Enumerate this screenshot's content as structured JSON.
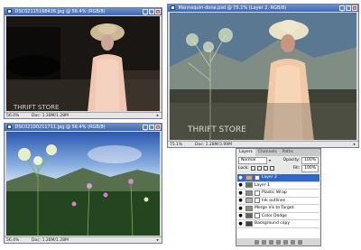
{
  "windows": [
    {
      "title": "DSC02115168426.jpg @ 56.4% (RGB/8)",
      "zoom": "56.4%",
      "doc": "Doc: 1.28M/1.28M",
      "sign_text": "THRIFT STORE"
    },
    {
      "title": "Mannequin-done.psd @ 75.1% (Layer 2, RGB/8)",
      "zoom": "75.1%",
      "doc": "Doc: 1.28M/3.99M",
      "sign_text": "THRIFT STORE"
    },
    {
      "title": "DSC02100211711.jpg @ 56.4% (RGB/8)",
      "zoom": "56.4%",
      "doc": "Doc: 1.28M/1.28M"
    }
  ],
  "layers_panel": {
    "tabs": [
      "Layers",
      "Channels",
      "Paths"
    ],
    "blend_mode": "Normal",
    "opacity_label": "Opacity:",
    "opacity_value": "100%",
    "lock_label": "Lock:",
    "fill_label": "Fill:",
    "fill_value": "100%",
    "layers": [
      {
        "name": "Layer 2",
        "selected": true
      },
      {
        "name": "Layer 1",
        "selected": false
      },
      {
        "name": "Plastic Wrap",
        "selected": false
      },
      {
        "name": "Ink outlines",
        "selected": false
      },
      {
        "name": "Merge Vis to Target",
        "selected": false
      },
      {
        "name": "Color Dodge",
        "selected": false
      },
      {
        "name": "Background copy",
        "selected": false
      }
    ]
  },
  "colors": {
    "titlebar": "#3e68b6",
    "selection": "#3165c8"
  }
}
